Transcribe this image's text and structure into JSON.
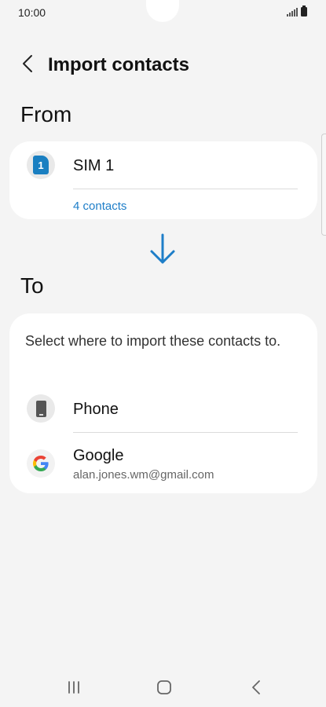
{
  "status_bar": {
    "time": "10:00"
  },
  "header": {
    "title": "Import contacts"
  },
  "from_section": {
    "title": "From",
    "source": {
      "name": "SIM 1",
      "badge": "1",
      "count_link": "4 contacts"
    }
  },
  "to_section": {
    "title": "To",
    "description": "Select where to import these contacts to.",
    "options": [
      {
        "name": "Phone"
      },
      {
        "name": "Google",
        "account": "alan.jones.wm@gmail.com"
      }
    ]
  },
  "colors": {
    "accent": "#1e7ec8",
    "sim_icon": "#1a7fc1",
    "background": "#f4f4f4",
    "card": "#ffffff"
  },
  "icons": {
    "back": "chevron-left-icon",
    "sim": "sim-card-icon",
    "arrow": "arrow-down-icon",
    "phone": "phone-icon",
    "google": "google-icon"
  }
}
